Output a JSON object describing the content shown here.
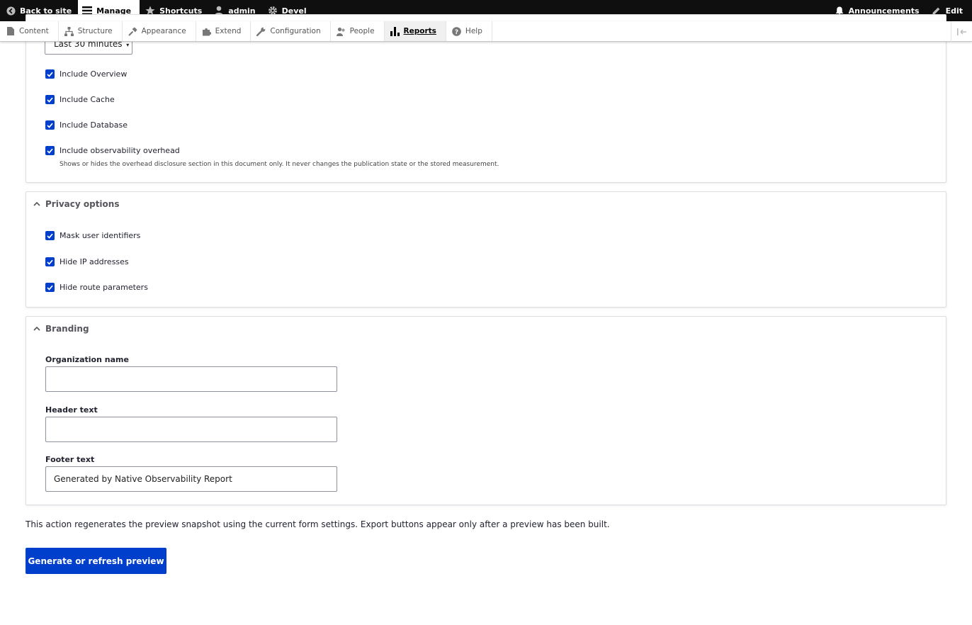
{
  "toolbar": {
    "back_to_site": "Back to site",
    "manage": "Manage",
    "shortcuts": "Shortcuts",
    "user": "admin",
    "devel": "Devel",
    "announcements": "Announcements",
    "edit": "Edit"
  },
  "tray": {
    "items": [
      "Content",
      "Structure",
      "Appearance",
      "Extend",
      "Configuration",
      "People",
      "Reports",
      "Help"
    ],
    "active": "Reports"
  },
  "report_options": {
    "time_range_value": "Last 30 minutes",
    "checkboxes": [
      {
        "label": "Include Overview",
        "checked": true
      },
      {
        "label": "Include Cache",
        "checked": true
      },
      {
        "label": "Include Database",
        "checked": true
      },
      {
        "label": "Include observability overhead",
        "checked": true
      }
    ],
    "overhead_description": "Shows or hides the overhead disclosure section in this document only. It never changes the publication state or the stored measurement."
  },
  "privacy": {
    "title": "Privacy options",
    "checkboxes": [
      {
        "label": "Mask user identifiers",
        "checked": true
      },
      {
        "label": "Hide IP addresses",
        "checked": true
      },
      {
        "label": "Hide route parameters",
        "checked": true
      }
    ]
  },
  "branding": {
    "title": "Branding",
    "organization_name_label": "Organization name",
    "organization_name_value": "",
    "header_text_label": "Header text",
    "header_text_value": "",
    "footer_text_label": "Footer text",
    "footer_text_value": "Generated by Native Observability Report"
  },
  "action_note": "This action regenerates the preview snapshot using the current form settings. Export buttons appear only after a preview has been built.",
  "primary_button": "Generate or refresh preview",
  "colors": {
    "toolbar_bg": "#0f0f0f",
    "accent": "#003ecc"
  }
}
